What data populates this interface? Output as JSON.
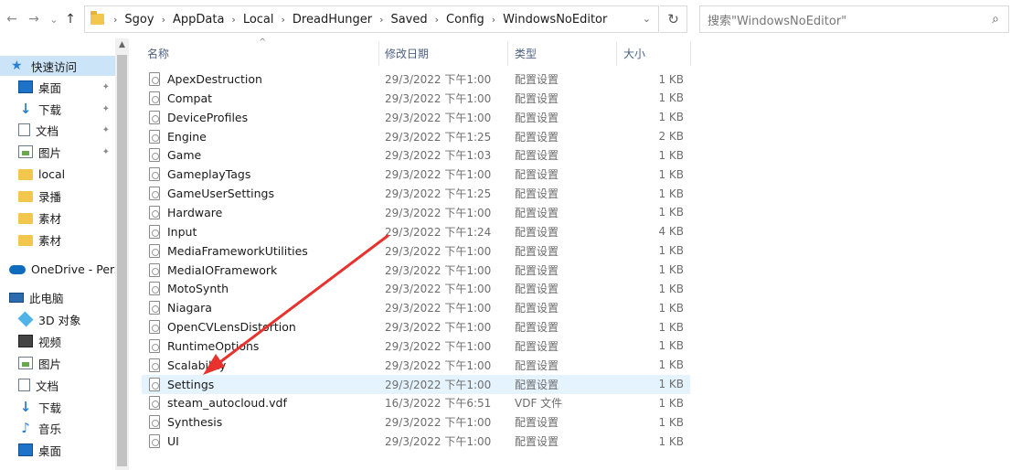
{
  "nav": {
    "back_icon": "←",
    "forward_icon": "→",
    "recent_icon": "⌄",
    "up_icon": "↑"
  },
  "address": {
    "root_sep": "›",
    "crumbs": [
      "Sgoy",
      "AppData",
      "Local",
      "DreadHunger",
      "Saved",
      "Config",
      "WindowsNoEditor"
    ],
    "dropdown_icon": "⌄",
    "refresh_icon": "↻"
  },
  "search": {
    "placeholder": "搜索\"WindowsNoEditor\"",
    "icon": "⌕"
  },
  "sidebar": {
    "items": [
      {
        "label": "快速访问",
        "icon": "star-icon",
        "pinned": false
      },
      {
        "label": "桌面",
        "icon": "desktop-icon",
        "pinned": true
      },
      {
        "label": "下载",
        "icon": "download-icon",
        "pinned": true
      },
      {
        "label": "文档",
        "icon": "document-icon",
        "pinned": true
      },
      {
        "label": "图片",
        "icon": "pictures-icon",
        "pinned": true
      },
      {
        "label": "local",
        "icon": "folder-icon",
        "pinned": false
      },
      {
        "label": "录播",
        "icon": "folder-icon",
        "pinned": false
      },
      {
        "label": "素材",
        "icon": "folder-icon",
        "pinned": false
      },
      {
        "label": "素材",
        "icon": "folder-icon",
        "pinned": false
      },
      {
        "label": "OneDrive - Pers",
        "icon": "onedrive-icon",
        "pinned": false
      },
      {
        "label": "此电脑",
        "icon": "this-pc-icon",
        "pinned": false
      },
      {
        "label": "3D 对象",
        "icon": "3d-objects-icon",
        "pinned": false
      },
      {
        "label": "视频",
        "icon": "videos-icon",
        "pinned": false
      },
      {
        "label": "图片",
        "icon": "pictures-icon",
        "pinned": false
      },
      {
        "label": "文档",
        "icon": "document-icon",
        "pinned": false
      },
      {
        "label": "下载",
        "icon": "download-icon",
        "pinned": false
      },
      {
        "label": "音乐",
        "icon": "music-icon",
        "pinned": false
      },
      {
        "label": "桌面",
        "icon": "desktop-icon",
        "pinned": false
      }
    ],
    "pin_icon": "📌"
  },
  "columns": {
    "name": "名称",
    "date": "修改日期",
    "type": "类型",
    "size": "大小",
    "sort_icon": "^"
  },
  "files": [
    {
      "name": "ApexDestruction",
      "date": "29/3/2022 下午1:00",
      "type": "配置设置",
      "size": "1 KB"
    },
    {
      "name": "Compat",
      "date": "29/3/2022 下午1:00",
      "type": "配置设置",
      "size": "1 KB"
    },
    {
      "name": "DeviceProfiles",
      "date": "29/3/2022 下午1:00",
      "type": "配置设置",
      "size": "1 KB"
    },
    {
      "name": "Engine",
      "date": "29/3/2022 下午1:25",
      "type": "配置设置",
      "size": "2 KB"
    },
    {
      "name": "Game",
      "date": "29/3/2022 下午1:03",
      "type": "配置设置",
      "size": "1 KB"
    },
    {
      "name": "GameplayTags",
      "date": "29/3/2022 下午1:00",
      "type": "配置设置",
      "size": "1 KB"
    },
    {
      "name": "GameUserSettings",
      "date": "29/3/2022 下午1:25",
      "type": "配置设置",
      "size": "1 KB"
    },
    {
      "name": "Hardware",
      "date": "29/3/2022 下午1:00",
      "type": "配置设置",
      "size": "1 KB"
    },
    {
      "name": "Input",
      "date": "29/3/2022 下午1:24",
      "type": "配置设置",
      "size": "4 KB"
    },
    {
      "name": "MediaFrameworkUtilities",
      "date": "29/3/2022 下午1:00",
      "type": "配置设置",
      "size": "1 KB"
    },
    {
      "name": "MediaIOFramework",
      "date": "29/3/2022 下午1:00",
      "type": "配置设置",
      "size": "1 KB"
    },
    {
      "name": "MotoSynth",
      "date": "29/3/2022 下午1:00",
      "type": "配置设置",
      "size": "1 KB"
    },
    {
      "name": "Niagara",
      "date": "29/3/2022 下午1:00",
      "type": "配置设置",
      "size": "1 KB"
    },
    {
      "name": "OpenCVLensDistortion",
      "date": "29/3/2022 下午1:00",
      "type": "配置设置",
      "size": "1 KB"
    },
    {
      "name": "RuntimeOptions",
      "date": "29/3/2022 下午1:00",
      "type": "配置设置",
      "size": "1 KB"
    },
    {
      "name": "Scalability",
      "date": "29/3/2022 下午1:00",
      "type": "配置设置",
      "size": "1 KB"
    },
    {
      "name": "Settings",
      "date": "29/3/2022 下午1:00",
      "type": "配置设置",
      "size": "1 KB"
    },
    {
      "name": "steam_autocloud.vdf",
      "date": "16/3/2022 下午6:51",
      "type": "VDF 文件",
      "size": "1 KB"
    },
    {
      "name": "Synthesis",
      "date": "29/3/2022 下午1:00",
      "type": "配置设置",
      "size": "1 KB"
    },
    {
      "name": "UI",
      "date": "29/3/2022 下午1:00",
      "type": "配置设置",
      "size": "1 KB"
    }
  ],
  "hovered_file": "Settings",
  "colors": {
    "selection": "#cce4f7",
    "hover": "#e5f3ff",
    "annotation_arrow": "#e8322d"
  }
}
